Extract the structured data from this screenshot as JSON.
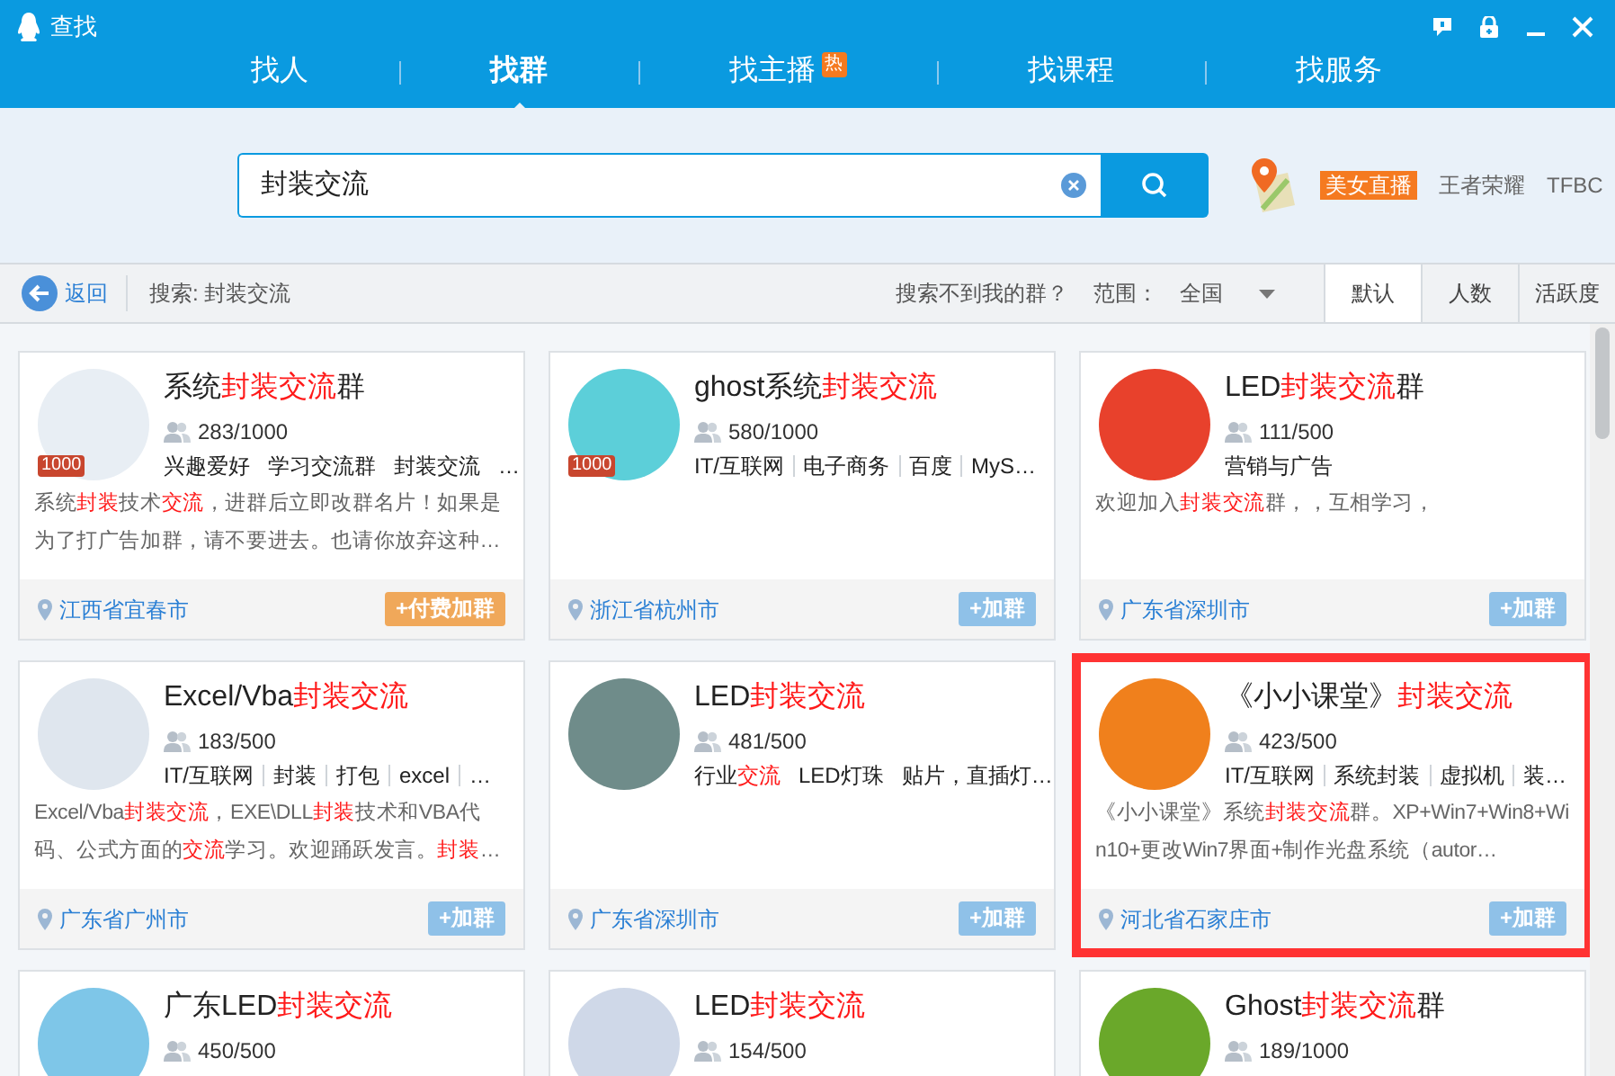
{
  "window": {
    "title": "查找"
  },
  "nav_tabs": [
    {
      "label": "找人",
      "selected": false
    },
    {
      "label": "找群",
      "selected": true
    },
    {
      "label": "找主播",
      "selected": false,
      "badge": "热"
    },
    {
      "label": "找课程",
      "selected": false
    },
    {
      "label": "找服务",
      "selected": false
    }
  ],
  "search": {
    "value": "封装交流"
  },
  "hot_links": [
    {
      "label": "美女直播",
      "kind": "highlight"
    },
    {
      "label": "王者荣耀",
      "kind": "plain"
    },
    {
      "label": "TFBC",
      "kind": "plain"
    }
  ],
  "toolbar": {
    "back": "返回",
    "query": "搜索: 封装交流",
    "help_link": "搜索不到我的群？",
    "scope_label": "范围：",
    "scope_value": "全国",
    "sort_tabs": [
      {
        "label": "默认",
        "selected": true
      },
      {
        "label": "人数",
        "selected": false
      },
      {
        "label": "活跃度",
        "selected": false
      }
    ]
  },
  "groups": [
    {
      "name": "系统**封装交流**群",
      "badge": "1000",
      "members": "283/1000",
      "tags": [
        "兴趣爱好",
        "学习交流群",
        "封装交流",
        "…"
      ],
      "description": "系统**封装**技术**交流**，进群后立即改群名片！如果是为了打广告加群，请不要进去。也请你放弃这种…",
      "location": "江西省宜春市",
      "button": {
        "label": "+付费加群",
        "kind": "paid"
      },
      "selected": false
    },
    {
      "name": "ghost系统**封装交流**",
      "badge": "1000",
      "members": "580/1000",
      "tags": [
        "IT/互联网",
        "电子商务",
        "百度",
        "MyS…"
      ],
      "location": "浙江省杭州市",
      "button": {
        "label": "+加群",
        "kind": "join"
      },
      "selected": false
    },
    {
      "name": "LED**封装交流**群",
      "members": "111/500",
      "tags": [
        "营销与广告"
      ],
      "description": "欢迎加入**封装交流**群，，互相学习，",
      "location": "广东省深圳市",
      "button": {
        "label": "+加群",
        "kind": "join"
      },
      "selected": false
    },
    {
      "name": "Excel/Vba**封装交流**",
      "members": "183/500",
      "tags": [
        "IT/互联网",
        "封装",
        "打包",
        "excel",
        "…"
      ],
      "description": "Excel/Vba**封装交流**，EXE\\DLL**封装**技术和VBA代码、公式方面的**交流**学习。欢迎踊跃发言。**封装**…",
      "location": "广东省广州市",
      "button": {
        "label": "+加群",
        "kind": "join"
      },
      "selected": false
    },
    {
      "name": "LED**封装交流**",
      "members": "481/500",
      "tags": [
        "行业**交流**",
        "LED灯珠",
        "贴片，直插灯…"
      ],
      "location": "广东省深圳市",
      "button": {
        "label": "+加群",
        "kind": "join"
      },
      "selected": false
    },
    {
      "name": "《小小课堂》**封装交流**",
      "members": "423/500",
      "tags": [
        "IT/互联网",
        "系统封装",
        "虚拟机",
        "装…"
      ],
      "description": "《小小课堂》系统**封装交流**群。XP+Win7+Win8+Win10+更改Win7界面+制作光盘系统（autor…",
      "location": "河北省石家庄市",
      "button": {
        "label": "+加群",
        "kind": "join"
      },
      "selected": true
    },
    {
      "name": "广东LED**封装交流**",
      "members": "450/500",
      "selected": false
    },
    {
      "name": "LED**封装交流**",
      "members": "154/500",
      "selected": false
    },
    {
      "name": "Ghost**封装交流**群",
      "members": "189/1000",
      "selected": false
    }
  ]
}
